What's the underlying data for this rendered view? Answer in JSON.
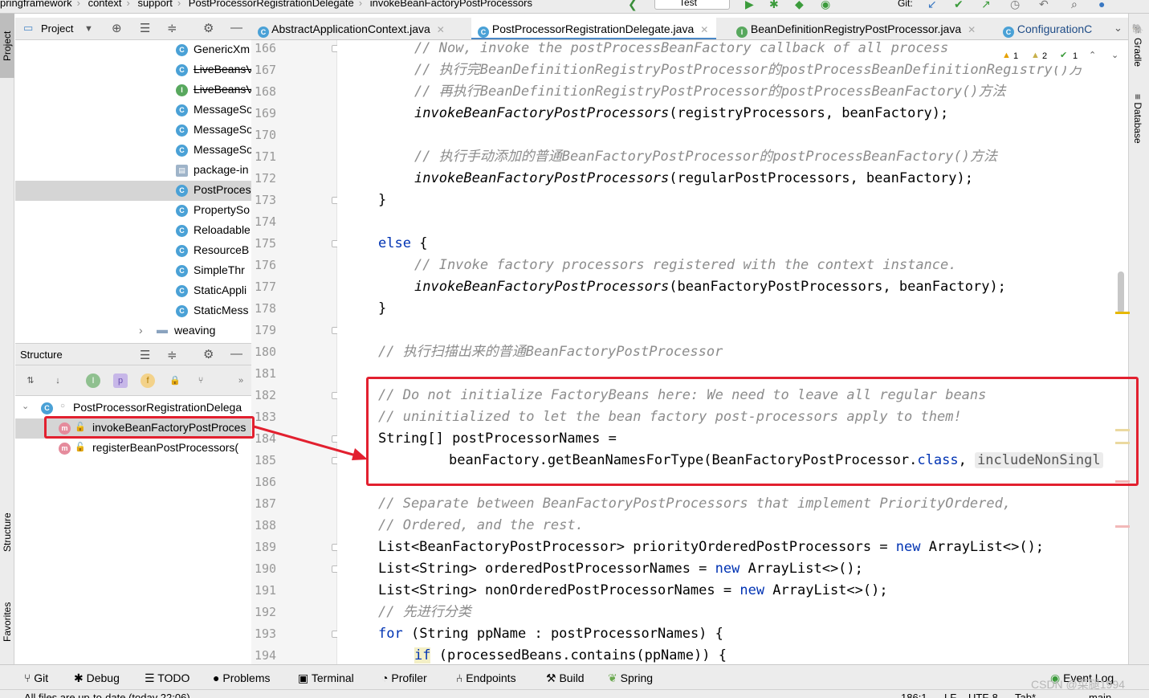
{
  "navbar": {
    "crumbs": [
      "pringframework",
      "context",
      "support",
      "PostProcessorRegistrationDelegate",
      "invokeBeanFactoryPostProcessors"
    ],
    "run_config": "Test",
    "git_label": "Git:"
  },
  "left_strip": {
    "project": "Project",
    "structure": "Structure",
    "favorites": "Favorites"
  },
  "right_strip": {
    "gradle": "Gradle",
    "database": "Database"
  },
  "project_panel": {
    "title": "Project",
    "items": [
      {
        "label": "GenericXm",
        "icon": "class-icon",
        "strike": false
      },
      {
        "label": "LiveBeansV",
        "icon": "class-icon",
        "strike": true
      },
      {
        "label": "LiveBeansV",
        "icon": "interface-icon",
        "strike": true
      },
      {
        "label": "MessageSo",
        "icon": "class-icon",
        "strike": false
      },
      {
        "label": "MessageSo",
        "icon": "class-icon",
        "strike": false
      },
      {
        "label": "MessageSo",
        "icon": "class-icon",
        "strike": false
      },
      {
        "label": "package-in",
        "icon": "package-info-icon",
        "strike": false
      },
      {
        "label": "PostProces",
        "icon": "class-icon",
        "strike": false
      },
      {
        "label": "PropertySo",
        "icon": "class-icon",
        "strike": false
      },
      {
        "label": "Reloadable",
        "icon": "class-icon",
        "strike": false
      },
      {
        "label": "ResourceB",
        "icon": "class-icon",
        "strike": false
      },
      {
        "label": "SimpleThr",
        "icon": "class-icon",
        "strike": false
      },
      {
        "label": "StaticAppli",
        "icon": "class-icon",
        "strike": false
      },
      {
        "label": "StaticMess",
        "icon": "class-icon",
        "strike": false
      },
      {
        "label": "weaving",
        "icon": "folder-icon",
        "strike": false
      }
    ]
  },
  "structure_panel": {
    "title": "Structure",
    "root": "PostProcessorRegistrationDelega",
    "methods": [
      "invokeBeanFactoryPostProces",
      "registerBeanPostProcessors("
    ]
  },
  "editor_tabs": [
    {
      "label": "AbstractApplicationContext.java",
      "active": false
    },
    {
      "label": "PostProcessorRegistrationDelegate.java",
      "active": true
    },
    {
      "label": "BeanDefinitionRegistryPostProcessor.java",
      "active": false
    },
    {
      "label": "ConfigurationC",
      "active": false
    }
  ],
  "inspections": {
    "warnings": "1",
    "weak_warnings": "2",
    "ok": "1"
  },
  "line_numbers": [
    "166",
    "167",
    "168",
    "169",
    "170",
    "171",
    "172",
    "173",
    "174",
    "175",
    "176",
    "177",
    "178",
    "179",
    "180",
    "181",
    "182",
    "183",
    "184",
    "185",
    "186",
    "187",
    "188",
    "189",
    "190",
    "191",
    "192",
    "193",
    "194"
  ],
  "code": {
    "l166": "// Now, invoke the postProcessBeanFactory callback of all process",
    "l167": "// 执行完BeanDefinitionRegistryPostProcessor的postProcessBeanDefinitionRegistry()方",
    "l168": "// 再执行BeanDefinitionRegistryPostProcessor的postProcessBeanFactory()方法",
    "l169_m": "invokeBeanFactoryPostProcessors",
    "l169_r": "(registryProcessors, beanFactory);",
    "l171": "// 执行手动添加的普通BeanFactoryPostProcessor的postProcessBeanFactory()方法",
    "l172_m": "invokeBeanFactoryPostProcessors",
    "l172_r": "(regularPostProcessors, beanFactory);",
    "l173": "}",
    "l175_k": "else",
    "l175_r": " {",
    "l176": "// Invoke factory processors registered with the context instance.",
    "l177_m": "invokeBeanFactoryPostProcessors",
    "l177_r": "(beanFactoryPostProcessors, beanFactory);",
    "l178": "}",
    "l180": "// 执行扫描出来的普通BeanFactoryPostProcessor",
    "l182": "// Do not initialize FactoryBeans here: We need to leave all regular beans",
    "l183": "// uninitialized to let the bean factory post-processors apply to them!",
    "l184": "String[] postProcessorNames =",
    "l185_a": "beanFactory.getBeanNamesForType(BeanFactoryPostProcessor.",
    "l185_k": "class",
    "l185_b": ", ",
    "l185_hint": "includeNonSingl",
    "l187": "// Separate between BeanFactoryPostProcessors that implement PriorityOrdered,",
    "l188": "// Ordered, and the rest.",
    "l189_a": "List<BeanFactoryPostProcessor> priorityOrderedPostProcessors = ",
    "l189_k": "new",
    "l189_b": " ArrayList<>();",
    "l190_a": "List<String> orderedPostProcessorNames = ",
    "l190_k": "new",
    "l190_b": " ArrayList<>();",
    "l191_a": "List<String> nonOrderedPostProcessorNames = ",
    "l191_k": "new",
    "l191_b": " ArrayList<>();",
    "l192": "// 先进行分类",
    "l193_k": "for",
    "l193_r": " (String ppName : postProcessorNames) {",
    "l194_k": "if",
    "l194_r": " (processedBeans.contains(ppName)) {"
  },
  "tool_windows": [
    "Git",
    "Debug",
    "TODO",
    "Problems",
    "Terminal",
    "Profiler",
    "Endpoints",
    "Build",
    "Spring"
  ],
  "event_log": "Event Log",
  "status": {
    "message": "All files are up-to-date (today 22:06)",
    "position": "186:1",
    "line_sep": "LF",
    "encoding": "UTF-8",
    "indent": "Tab*",
    "branch": "main"
  },
  "watermark": "CSDN @菜腿1994",
  "colors": {
    "highlight_red": "#e2202f",
    "keyword": "#0033b3",
    "comment": "#8c8c8c",
    "class_icon": "#4aa1d6"
  }
}
